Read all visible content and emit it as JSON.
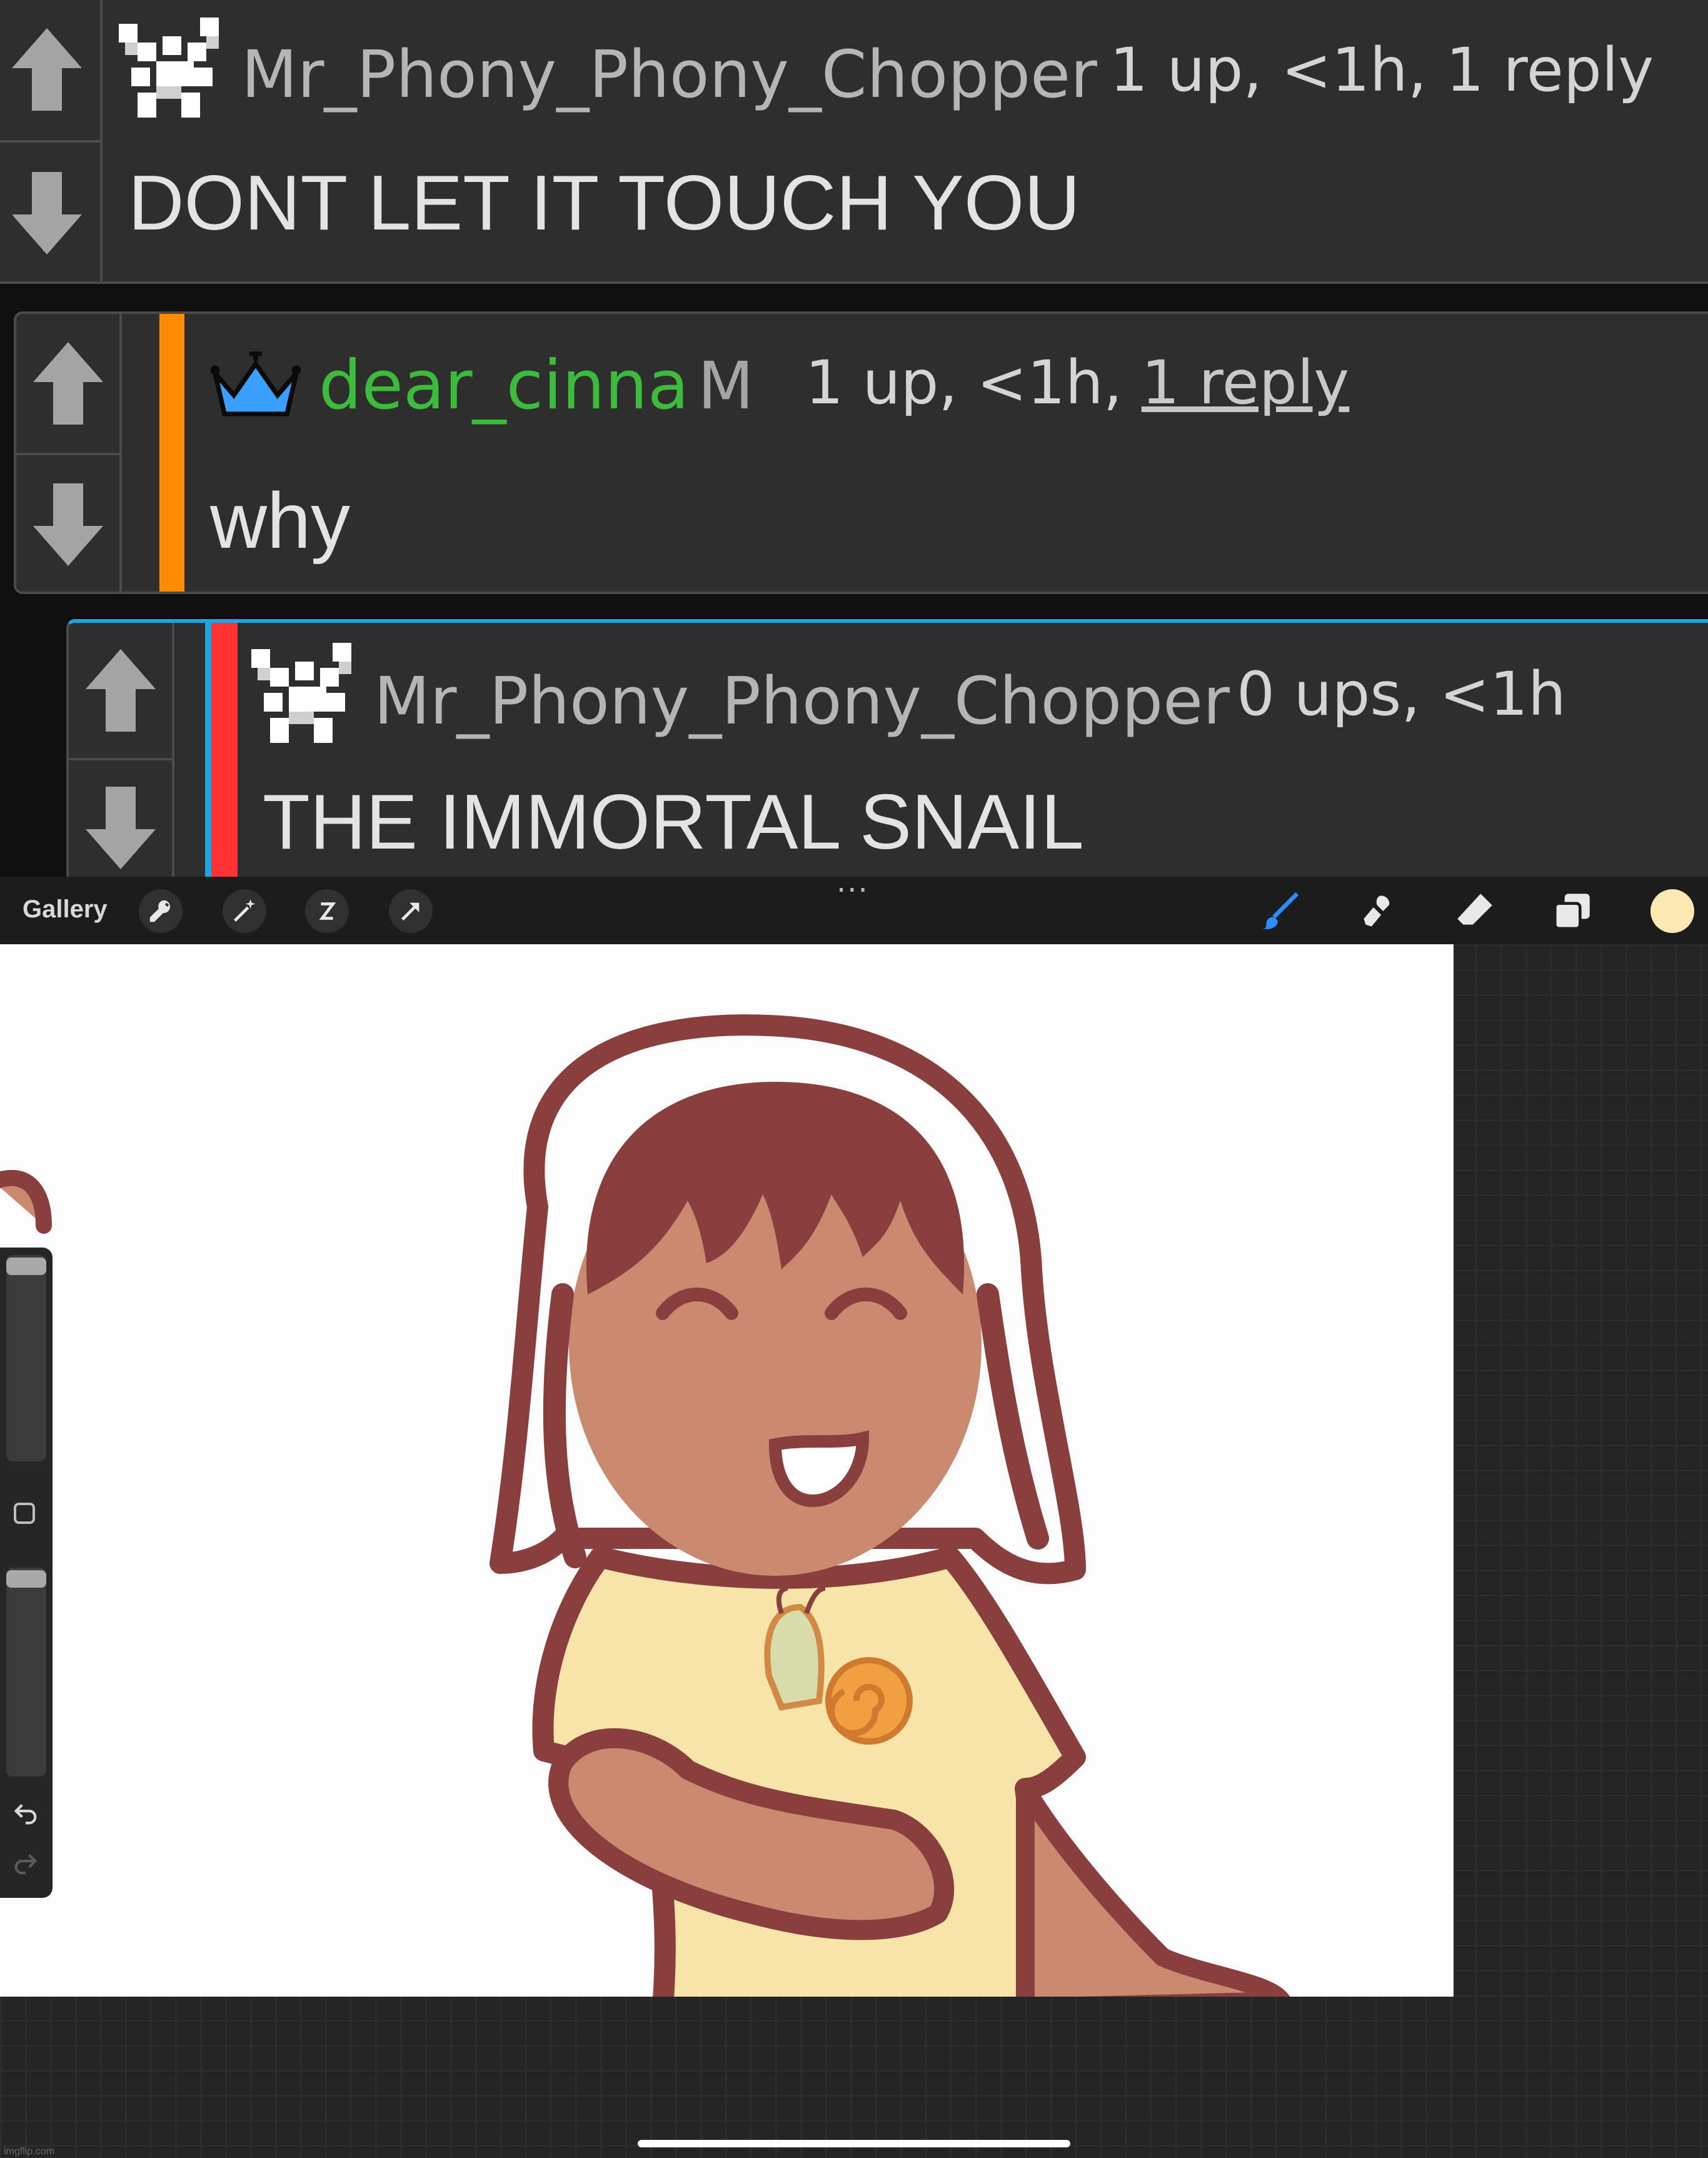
{
  "comments": [
    {
      "username": "Mr_Phony_Phony_Chopper",
      "meta": "1 up, <1h, 1 reply",
      "text": "DONT LET IT TOUCH YOU",
      "bar_color": null
    },
    {
      "username": "dear_cinna",
      "mod_badge": "M",
      "meta_prefix": "1 up, <1h, ",
      "meta_link": "1 reply",
      "text": "why",
      "bar_color": "#ff8c00",
      "username_color": "#3dbb3d",
      "crown_color": "#3aa0ff"
    },
    {
      "username": "Mr_Phony_Phony_Chopper",
      "meta": "0 ups, <1h",
      "text": "THE IMMORTAL SNAIL",
      "bar_color": "#ff3333",
      "highlight_border": "#1aa7e0"
    }
  ],
  "toolbar": {
    "gallery_label": "Gallery",
    "more_label": "...",
    "left_icons": [
      "wrench-icon",
      "magic-wand-icon",
      "selection-icon",
      "arrow-transform-icon"
    ],
    "right_icons": [
      "brush-icon",
      "smudge-icon",
      "eraser-icon",
      "layers-icon",
      "color-swatch-icon"
    ],
    "active_color": "#fbe9b4",
    "brush_color": "#2f8cff"
  },
  "drawing": {
    "hair_color": "#8a3f3f",
    "skin_color": "#c98a6f",
    "shirt_color": "#f8e4a8",
    "snail_shell_color": "#f0a040",
    "snail_body_color": "#d8dcaa"
  },
  "watermark": "imgflip.com"
}
